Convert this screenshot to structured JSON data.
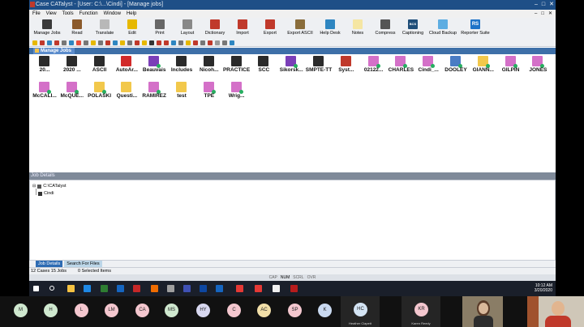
{
  "window": {
    "title": "Case CATalyst - [User: C:\\...\\Cindi] - [Manage jobs]",
    "controls": [
      "–",
      "□",
      "✕"
    ]
  },
  "menu": {
    "items": [
      "File",
      "View",
      "Tools",
      "Function",
      "Window",
      "Help"
    ],
    "window_buttons": [
      "–",
      "□",
      "✕"
    ]
  },
  "toolbar": {
    "buttons": [
      {
        "label": "Manage Jobs",
        "icon": "folder-case-icon",
        "color": "#3a3a3a"
      },
      {
        "label": "Read",
        "icon": "read-icon",
        "color": "#8b5a2b"
      },
      {
        "label": "Translate",
        "icon": "translate-icon",
        "color": "#b8b8b8"
      },
      {
        "label": "Edit",
        "icon": "edit-icon",
        "color": "#e6b800"
      },
      {
        "label": "Print",
        "icon": "printer-icon",
        "color": "#666666"
      },
      {
        "label": "Layout",
        "icon": "layout-icon",
        "color": "#888888"
      },
      {
        "label": "Dictionary",
        "icon": "dictionary-icon",
        "color": "#c0392b"
      },
      {
        "label": "Import",
        "icon": "import-icon",
        "color": "#c0392b"
      },
      {
        "label": "Export",
        "icon": "export-icon",
        "color": "#c0392b"
      },
      {
        "label": "Export ASCII",
        "icon": "export-ascii-icon",
        "color": "#8a6d3b"
      },
      {
        "label": "Help Desk",
        "icon": "help-desk-icon",
        "color": "#2e86c1"
      },
      {
        "label": "Notes",
        "icon": "notes-icon",
        "color": "#f5e6a3"
      },
      {
        "label": "Compress",
        "icon": "compress-icon",
        "color": "#555555"
      },
      {
        "label": "Captioning",
        "icon": "captioning-icon",
        "color": "#1f4e79"
      },
      {
        "label": "Cloud Backup",
        "icon": "cloud-backup-icon",
        "color": "#5dade2"
      },
      {
        "label": "Reporter Suite",
        "icon": "reporter-suite-icon",
        "color": "#1e73c8"
      }
    ],
    "rs_text": "RS",
    "bcs_text": "BCS"
  },
  "secondary_toolbar_colors": [
    "#e6b800",
    "#c0392b",
    "#2e86c1",
    "#c0392b",
    "#777",
    "#2e86c1",
    "#e74c3c",
    "#777",
    "#e6b800",
    "#777",
    "#c0392b",
    "#2e86c1",
    "#e6b800",
    "#777",
    "#c0392b",
    "#e6b800",
    "#333",
    "#c0392b",
    "#c0392b",
    "#2e86c1",
    "#777",
    "#e6b800",
    "#c0392b",
    "#777",
    "#c0392b",
    "#999",
    "#777",
    "#2e86c1"
  ],
  "tab": {
    "label": "Manage Jobs"
  },
  "jobs": [
    {
      "name": "20...",
      "color": "#2b2b2b",
      "dot": ""
    },
    {
      "name": "2020 ...",
      "color": "#2b2b2b",
      "dot": ""
    },
    {
      "name": "ASCII",
      "color": "#2b2b2b",
      "dot": ""
    },
    {
      "name": "AutoAr...",
      "color": "#d22a2a",
      "dot": ""
    },
    {
      "name": "Beauvais",
      "color": "#7b3fb8",
      "dot": "#27ae60"
    },
    {
      "name": "Includes",
      "color": "#2b2b2b",
      "dot": ""
    },
    {
      "name": "Nicoh...",
      "color": "#2b2b2b",
      "dot": ""
    },
    {
      "name": "PRACTICE",
      "color": "#2b2b2b",
      "dot": ""
    },
    {
      "name": "SCC",
      "color": "#2b2b2b",
      "dot": ""
    },
    {
      "name": "Sikorsk...",
      "color": "#7b3fb8",
      "dot": "#27ae60"
    },
    {
      "name": "SMPTE-TT",
      "color": "#2b2b2b",
      "dot": ""
    },
    {
      "name": "Syst...",
      "color": "#c0392b",
      "dot": ""
    },
    {
      "name": "02122...",
      "color": "#d470c8",
      "dot": "#27ae60"
    },
    {
      "name": "CHARLES",
      "color": "#d470c8",
      "dot": "#27ae60"
    },
    {
      "name": "Cindi_...",
      "color": "#d470c8",
      "dot": "#27ae60"
    },
    {
      "name": "DOOLEY",
      "color": "#4a7cc4",
      "dot": "#27ae60"
    },
    {
      "name": "GIANN...",
      "color": "#f2c84b",
      "dot": "#27ae60"
    },
    {
      "name": "GILPIN",
      "color": "#d470c8",
      "dot": "#27ae60"
    },
    {
      "name": "JONES",
      "color": "#d470c8",
      "dot": "#27ae60"
    },
    {
      "name": "McCALI...",
      "color": "#d470c8",
      "dot": "#27ae60"
    },
    {
      "name": "McQUE...",
      "color": "#d470c8",
      "dot": "#27ae60"
    },
    {
      "name": "POLASKI",
      "color": "#f2c84b",
      "dot": "#27ae60"
    },
    {
      "name": "Questi...",
      "color": "#f2c84b",
      "dot": ""
    },
    {
      "name": "RAMIREZ",
      "color": "#d470c8",
      "dot": "#27ae60"
    },
    {
      "name": "test",
      "color": "#f2c84b",
      "dot": ""
    },
    {
      "name": "TPE",
      "color": "#d470c8",
      "dot": "#27ae60"
    },
    {
      "name": "Wrig...",
      "color": "#d470c8",
      "dot": "#27ae60"
    }
  ],
  "job_details": {
    "header": "Job Details",
    "tree": [
      {
        "label": "C:\\CATalyst"
      },
      {
        "label": "Cindi"
      }
    ]
  },
  "panel_tabs": [
    {
      "label": "Job Details",
      "active": true
    },
    {
      "label": "Search For Files",
      "active": false
    }
  ],
  "status": {
    "cases_jobs": "12 Cases  15 Jobs",
    "selected": "0 Selected Items"
  },
  "key_status": [
    "CAP",
    "NUM",
    "SCRL",
    "OVR"
  ],
  "taskbar": {
    "time": "10:12 AM",
    "date": "3/20/2020",
    "icon_colors": [
      "#ffffff",
      "#ffffff",
      "#f5c242",
      "#1e88e5",
      "#2e7d32",
      "#1565c0",
      "#c62828",
      "#ef6c00",
      "#9e9e9e",
      "#3f51b5",
      "#0d47a1",
      "#1565c0",
      "#e53935",
      "#e53935",
      "#f0f0f0",
      "#b71c1c"
    ]
  },
  "participants": [
    {
      "initials": "M",
      "color": "#cfe8cf"
    },
    {
      "initials": "H",
      "color": "#cfe8cf"
    },
    {
      "initials": "L",
      "color": "#f4c7cf"
    },
    {
      "initials": "LM",
      "color": "#f4c7cf"
    },
    {
      "initials": "CA",
      "color": "#f4c7cf"
    },
    {
      "initials": "MS",
      "color": "#cfe8cf"
    },
    {
      "initials": "HY",
      "color": "#d8d8f0"
    },
    {
      "initials": "C",
      "color": "#f4c7cf"
    },
    {
      "initials": "AC",
      "color": "#f2dfa8"
    },
    {
      "initials": "SP",
      "color": "#f4c7cf"
    },
    {
      "initials": "K",
      "color": "#c9d9f0"
    }
  ],
  "named_tiles": [
    {
      "initials": "HC",
      "name": "Heather Clapett",
      "color": "#d4e4f4"
    },
    {
      "initials": "KR",
      "name": "Karen Reedy",
      "color": "#f4c7cf"
    }
  ]
}
